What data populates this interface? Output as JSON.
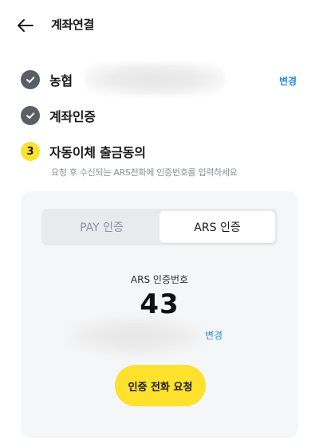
{
  "header": {
    "back_icon": "arrow-left-icon",
    "title": "계좌연결"
  },
  "steps": [
    {
      "status": "done",
      "icon": "check-icon",
      "label": "농협"
    },
    {
      "status": "done",
      "icon": "check-icon",
      "label": "계좌인증"
    },
    {
      "status": "active",
      "number": "3",
      "label": "자동이체 출금동의"
    }
  ],
  "account_change_label": "변경",
  "instruction": "요청 후 수신되는 ARS전화에 인증번호를 입력하세요",
  "auth_card": {
    "tabs": [
      {
        "label": "PAY 인증",
        "selected": false
      },
      {
        "label": "ARS 인증",
        "selected": true
      }
    ],
    "ars_label": "ARS 인증번호",
    "ars_code": "43",
    "phone_change_label": "변경",
    "call_button_label": "인증 전화 요청"
  },
  "colors": {
    "accent_yellow": "#fde12d",
    "link_blue": "#2a8bd6",
    "done_gray": "#5a5f66",
    "card_bg": "#f5f6f8"
  }
}
